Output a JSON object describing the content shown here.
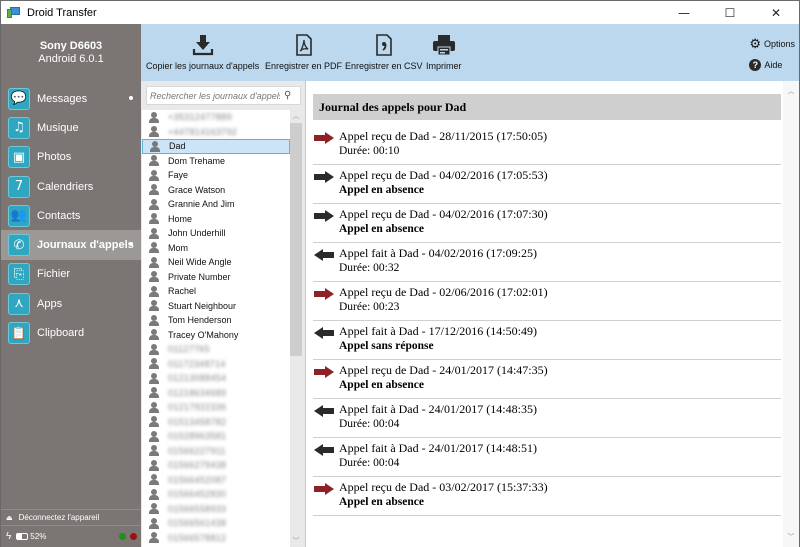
{
  "window": {
    "title": "Droid Transfer",
    "controls": {
      "minimize": "—",
      "maximize": "☐",
      "close": "✕"
    }
  },
  "device": {
    "name": "Sony D6603",
    "os": "Android 6.0.1"
  },
  "sidebar": {
    "items": [
      {
        "label": "Messages",
        "icon": "speech-bubble-icon",
        "glyph": "💬",
        "dot": true,
        "active": false
      },
      {
        "label": "Musique",
        "icon": "music-note-icon",
        "glyph": "♫",
        "dot": false,
        "active": false
      },
      {
        "label": "Photos",
        "icon": "photos-icon",
        "glyph": "▣",
        "dot": false,
        "active": false
      },
      {
        "label": "Calendriers",
        "icon": "calendar-icon",
        "glyph": "7",
        "dot": false,
        "active": false
      },
      {
        "label": "Contacts",
        "icon": "contacts-icon",
        "glyph": "👥",
        "dot": false,
        "active": false
      },
      {
        "label": "Journaux d'appels",
        "icon": "phone-icon",
        "glyph": "✆",
        "dot": true,
        "active": true
      },
      {
        "label": "Fichier",
        "icon": "file-icon",
        "glyph": "⎘",
        "dot": false,
        "active": false
      },
      {
        "label": "Apps",
        "icon": "apps-icon",
        "glyph": "⋏",
        "dot": false,
        "active": false
      },
      {
        "label": "Clipboard",
        "icon": "clipboard-icon",
        "glyph": "📋",
        "dot": false,
        "active": false
      }
    ],
    "footer": {
      "disconnect_label": "Déconnectez l'appareil",
      "battery_percent": 52,
      "battery_label": "52%",
      "status_colors": [
        "#1f8f1f",
        "#9b1010"
      ]
    }
  },
  "toolbar": {
    "buttons": [
      {
        "label": "Copier les journaux d'appels",
        "icon": "download-icon"
      },
      {
        "label": "Enregistrer en PDF",
        "icon": "pdf-file-icon"
      },
      {
        "label": "Enregistrer en CSV",
        "icon": "csv-file-icon"
      },
      {
        "label": "Imprimer",
        "icon": "printer-icon"
      }
    ],
    "options_label": "Options",
    "help_label": "Aide"
  },
  "search": {
    "placeholder": "Rechercher les journaux d'appels",
    "value": ""
  },
  "contacts": [
    {
      "name": "+35312477889",
      "blurred": true
    },
    {
      "name": "+447814163792",
      "blurred": true
    },
    {
      "name": "Dad",
      "blurred": false,
      "selected": true
    },
    {
      "name": "Dom Trehame",
      "blurred": false
    },
    {
      "name": "Faye",
      "blurred": false
    },
    {
      "name": "Grace Watson",
      "blurred": false
    },
    {
      "name": "Grannie And Jim",
      "blurred": false
    },
    {
      "name": "Home",
      "blurred": false
    },
    {
      "name": "John Underhill",
      "blurred": false
    },
    {
      "name": "Mom",
      "blurred": false
    },
    {
      "name": "Neil Wide Angle",
      "blurred": false
    },
    {
      "name": "Private Number",
      "blurred": false
    },
    {
      "name": "Rachel",
      "blurred": false
    },
    {
      "name": "Stuart Neighbour",
      "blurred": false
    },
    {
      "name": "Tom Henderson",
      "blurred": false
    },
    {
      "name": "Tracey O'Mahony",
      "blurred": false
    },
    {
      "name": "01127765",
      "blurred": true
    },
    {
      "name": "01172348714",
      "blurred": true
    },
    {
      "name": "01213088454",
      "blurred": true
    },
    {
      "name": "01218634689",
      "blurred": true
    },
    {
      "name": "01217922336",
      "blurred": true
    },
    {
      "name": "01513458782",
      "blurred": true
    },
    {
      "name": "01528963581",
      "blurred": true
    },
    {
      "name": "01566227911",
      "blurred": true
    },
    {
      "name": "01566279438",
      "blurred": true
    },
    {
      "name": "01566452087",
      "blurred": true
    },
    {
      "name": "01566452830",
      "blurred": true
    },
    {
      "name": "01566558933",
      "blurred": true
    },
    {
      "name": "01566561438",
      "blurred": true
    },
    {
      "name": "01566578812",
      "blurred": true
    }
  ],
  "log": {
    "header": "Journal des appels pour Dad",
    "entries": [
      {
        "direction": "incoming",
        "answered": true,
        "title": "Appel reçu de Dad - 28/11/2015 (17:50:05)",
        "detail": "Durée: 00:10",
        "bold": false
      },
      {
        "direction": "incoming",
        "answered": false,
        "title": "Appel reçu de Dad - 04/02/2016 (17:05:53)",
        "detail": "Appel en absence",
        "bold": true
      },
      {
        "direction": "incoming",
        "answered": false,
        "title": "Appel reçu de Dad - 04/02/2016 (17:07:30)",
        "detail": "Appel en absence",
        "bold": true
      },
      {
        "direction": "outgoing",
        "answered": true,
        "title": "Appel fait à Dad - 04/02/2016 (17:09:25)",
        "detail": "Durée: 00:32",
        "bold": false
      },
      {
        "direction": "incoming",
        "answered": true,
        "title": "Appel reçu de Dad - 02/06/2016 (17:02:01)",
        "detail": "Durée: 00:23",
        "bold": false
      },
      {
        "direction": "outgoing",
        "answered": false,
        "title": "Appel fait à Dad - 17/12/2016 (14:50:49)",
        "detail": "Appel sans réponse",
        "bold": true
      },
      {
        "direction": "incoming",
        "answered": true,
        "title": "Appel reçu de Dad - 24/01/2017 (14:47:35)",
        "detail": "Appel en absence",
        "bold": true
      },
      {
        "direction": "outgoing",
        "answered": true,
        "title": "Appel fait à Dad - 24/01/2017 (14:48:35)",
        "detail": "Durée: 00:04",
        "bold": false
      },
      {
        "direction": "outgoing",
        "answered": true,
        "title": "Appel fait à Dad - 24/01/2017 (14:48:51)",
        "detail": "Durée: 00:04",
        "bold": false
      },
      {
        "direction": "incoming",
        "answered": true,
        "title": "Appel reçu de Dad - 03/02/2017 (15:37:33)",
        "detail": "Appel en absence",
        "bold": true
      }
    ],
    "colors": {
      "red_arrow": "#8e2126",
      "black_arrow": "#2a2a2a"
    }
  },
  "colors": {
    "sidebar_bg": "#7b7673",
    "sidebar_active": "#9b9896",
    "icon_teal": "#2fa7c1",
    "toolbar_bg": "#bcd8ee",
    "selection_bg": "#cce4f7"
  }
}
